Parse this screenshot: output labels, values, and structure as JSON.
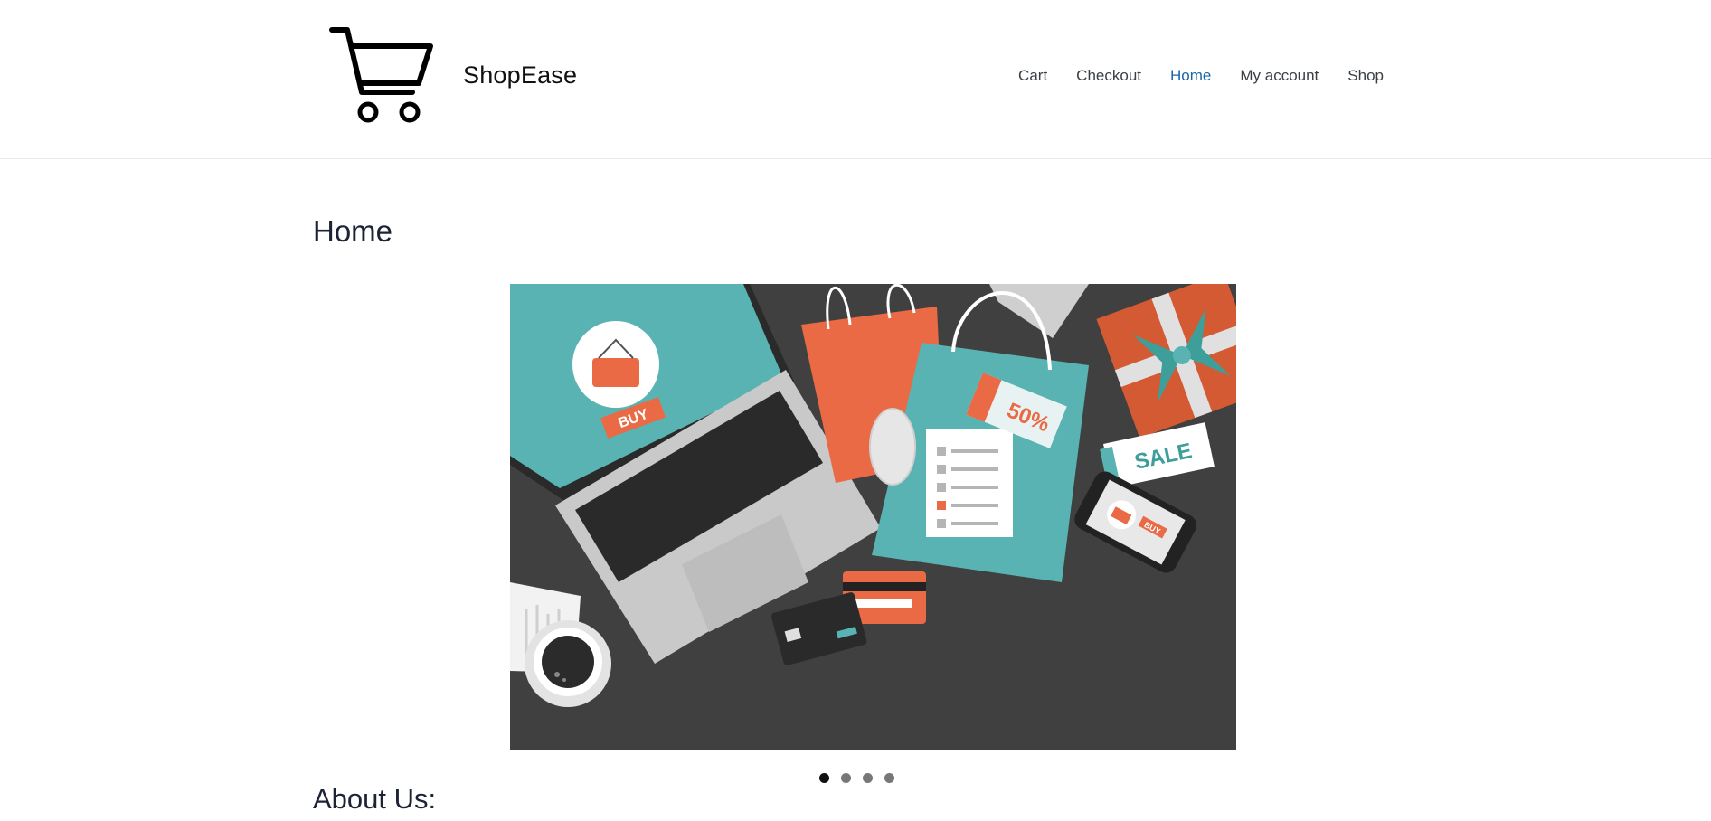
{
  "site": {
    "brand": "ShopEase",
    "logo_icon": "shopping-cart-icon"
  },
  "nav": [
    {
      "label": "Cart",
      "active": false
    },
    {
      "label": "Checkout",
      "active": false
    },
    {
      "label": "Home",
      "active": true
    },
    {
      "label": "My account",
      "active": false
    },
    {
      "label": "Shop",
      "active": false
    }
  ],
  "main": {
    "title": "Home",
    "about_heading": "About Us:"
  },
  "carousel": {
    "slide_count": 4,
    "active_index": 0,
    "image_text": {
      "buy": "BUY",
      "discount": "50%",
      "sale": "SALE",
      "phone_buy": "BUY"
    }
  },
  "colors": {
    "nav_active": "#1a67a8",
    "teal": "#5ab3b3",
    "orange": "#e96a45",
    "desk": "#404040"
  }
}
